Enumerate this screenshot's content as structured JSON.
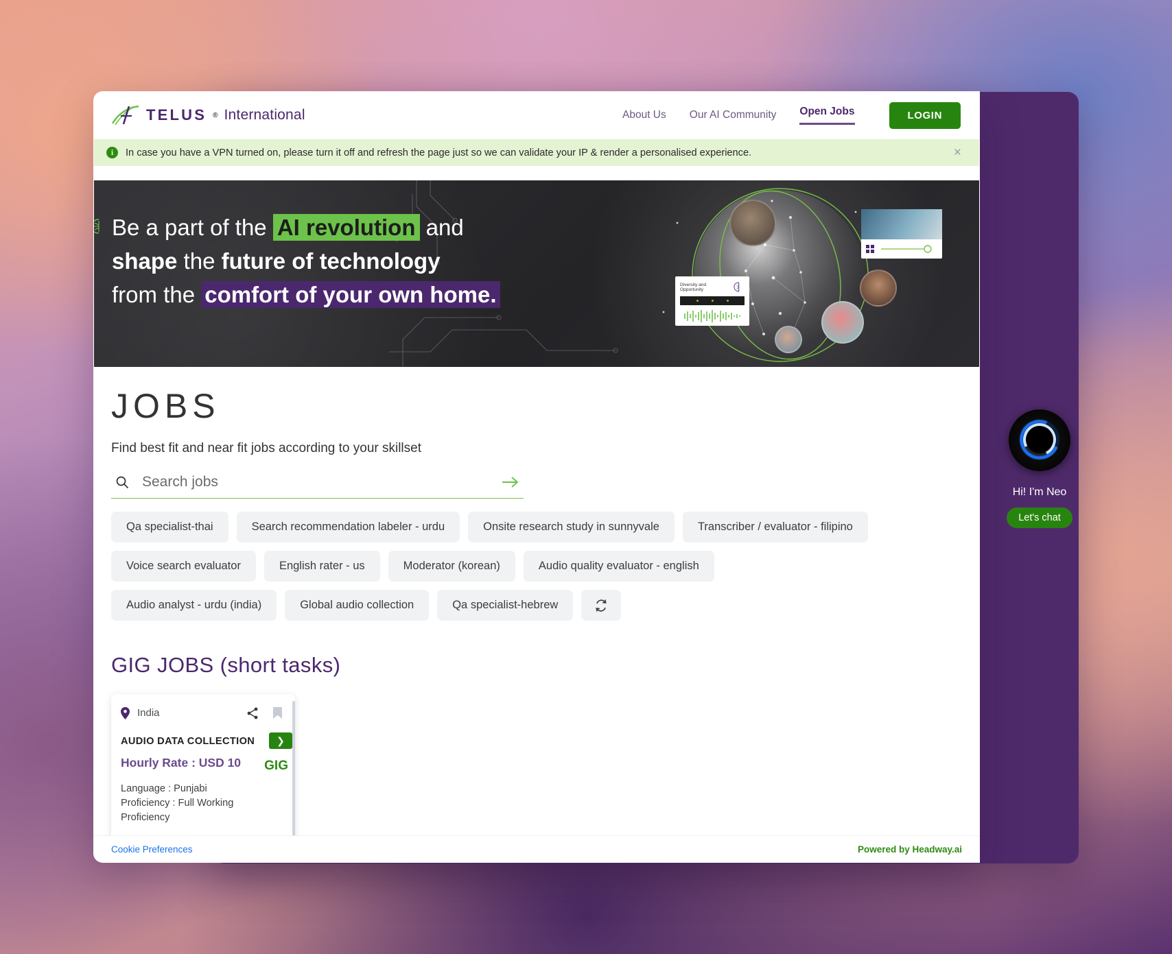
{
  "header": {
    "logo_brand": "TELUS",
    "logo_trademark": "®",
    "logo_suffix": "International",
    "nav": [
      {
        "label": "About Us",
        "active": false
      },
      {
        "label": "Our AI Community",
        "active": false
      },
      {
        "label": "Open Jobs",
        "active": true
      }
    ],
    "login_label": "LOGIN"
  },
  "vpn_banner": {
    "icon": "info-icon",
    "message": "In case you have a VPN turned on, please turn it off and refresh the page just so we can validate your IP & render a personalised experience.",
    "close_label": "×",
    "background": "#e4f3d2"
  },
  "hero": {
    "line1_a": "Be a part of the ",
    "line1_highlight": "AI revolution",
    "line1_b": " and",
    "line2_a": "shape",
    "line2_b": " the ",
    "line2_c": "future of technology",
    "line3_a": "from the ",
    "line3_highlight": "comfort of your own home.",
    "collage_card_label": "Diversity and Opportunity",
    "highlight_green": "#6cc24a",
    "highlight_purple": "#4b286d"
  },
  "jobs": {
    "title": "JOBS",
    "subtitle": "Find best fit and near fit jobs according to your skillset",
    "search_placeholder": "Search jobs",
    "search_value": "",
    "search_icon": "search-icon",
    "submit_icon": "arrow-right-icon",
    "chips": [
      "Qa specialist-thai",
      "Search recommendation labeler - urdu",
      "Onsite research study in sunnyvale",
      "Transcriber / evaluator - filipino",
      "Voice search evaluator",
      "English rater - us",
      "Moderator (korean)",
      "Audio quality evaluator - english",
      "Audio analyst - urdu (india)",
      "Global audio collection",
      "Qa specialist-hebrew"
    ],
    "refresh_icon": "refresh-icon"
  },
  "gig": {
    "section_title": "GIG JOBS (short tasks)",
    "cards": [
      {
        "location": "India",
        "location_icon": "map-pin-icon",
        "share_icon": "share-icon",
        "bookmark_icon": "bookmark-icon",
        "title": "AUDIO DATA COLLECTION",
        "rate": "Hourly Rate : USD 10",
        "badge": "GIG",
        "next_icon": "chevron-right-icon",
        "language": "Language : Punjabi",
        "proficiency": "Proficiency : Full Working Proficiency",
        "expand_icon": "chevron-down-icon"
      }
    ]
  },
  "footer": {
    "cookie_label": "Cookie Preferences",
    "powered_by": "Powered by Headway.ai"
  },
  "neo": {
    "orb_icon": "neo-orb-icon",
    "greeting": "Hi! I'm Neo",
    "cta_label": "Let's chat"
  }
}
